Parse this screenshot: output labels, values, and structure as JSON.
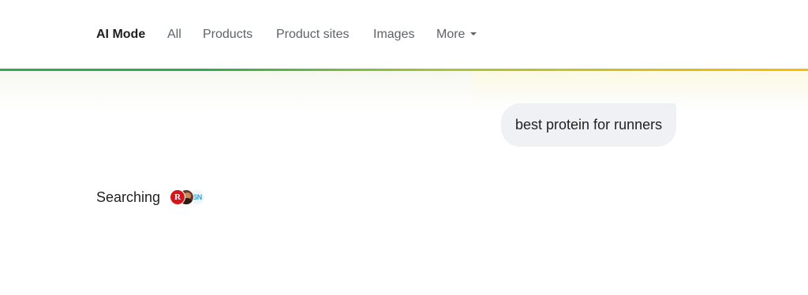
{
  "tabs": [
    {
      "label": "AI Mode",
      "active": true
    },
    {
      "label": "All",
      "active": false
    },
    {
      "label": "Products",
      "active": false
    },
    {
      "label": "Product sites",
      "active": false
    },
    {
      "label": "Images",
      "active": false
    },
    {
      "label": "More",
      "active": false,
      "has_dropdown": true
    }
  ],
  "query": {
    "text": "best protein for runners"
  },
  "status": {
    "label": "Searching",
    "source_icons": [
      "red-r-logo-icon",
      "person-avatar-icon",
      "sn-logo-icon"
    ]
  },
  "colors": {
    "accent_gradient": [
      "#34a853",
      "#fbbc04"
    ],
    "active_tab_text": "#1f1f1f",
    "inactive_tab_text": "#5f6368",
    "query_bubble_bg": "#eff1f4"
  }
}
